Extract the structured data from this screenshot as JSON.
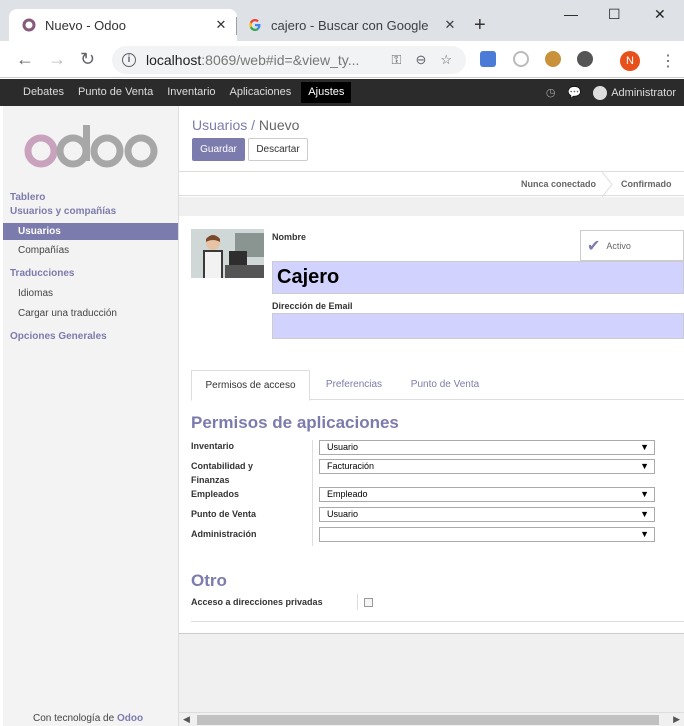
{
  "browser": {
    "tabs": [
      {
        "title": "Nuevo - Odoo",
        "close": "✕"
      },
      {
        "title": "cajero - Buscar con Google",
        "close": "✕"
      }
    ],
    "new_tab": "+",
    "window_controls": {
      "minimize": "—",
      "maximize": "☐",
      "close": "✕"
    },
    "url_host": "localhost",
    "url_rest": ":8069/web#id=&view_ty...",
    "profile_initial": "N"
  },
  "odoo_nav": {
    "menu": [
      "Debates",
      "Punto de Venta",
      "Inventario",
      "Aplicaciones"
    ],
    "active": "Ajustes",
    "user": "Administrator"
  },
  "sidebar": {
    "logo_text": "odoo",
    "sections": [
      {
        "label": "Tablero"
      },
      {
        "label": "Usuarios y compañías"
      },
      {
        "label": "Traducciones"
      },
      {
        "label": "Opciones Generales"
      }
    ],
    "items": {
      "usuarios": "Usuarios",
      "companias": "Compañías",
      "idiomas": "Idiomas",
      "cargar": "Cargar una traducción"
    },
    "powered_prefix": "Con tecnología de",
    "powered_brand": "Odoo"
  },
  "main": {
    "breadcrumb_parent": "Usuarios",
    "breadcrumb_sep": "/",
    "breadcrumb_current": "Nuevo",
    "save_label": "Guardar",
    "discard_label": "Descartar",
    "stages": [
      "Nunca conectado",
      "Confirmado"
    ],
    "form": {
      "name_label": "Nombre",
      "name_value": "Cajero",
      "email_label": "Dirección de Email",
      "email_value": "",
      "active_label": "Activo"
    },
    "tabs": [
      "Permisos de acceso",
      "Preferencias",
      "Punto de Venta"
    ],
    "permissions_title": "Permisos de aplicaciones",
    "permissions": [
      {
        "label": "Inventario",
        "value": "Usuario"
      },
      {
        "label": "Contabilidad y Finanzas",
        "value": "Facturación"
      },
      {
        "label": "Empleados",
        "value": "Empleado"
      },
      {
        "label": "Punto de Venta",
        "value": "Usuario"
      },
      {
        "label": "Administración",
        "value": ""
      }
    ],
    "other_title": "Otro",
    "private_address_label": "Acceso a direcciones privadas",
    "private_address_checked": false
  },
  "colors": {
    "brand": "#7c7bad",
    "nav_bg": "#2b2b2b",
    "required_field": "#d2d2ff"
  }
}
